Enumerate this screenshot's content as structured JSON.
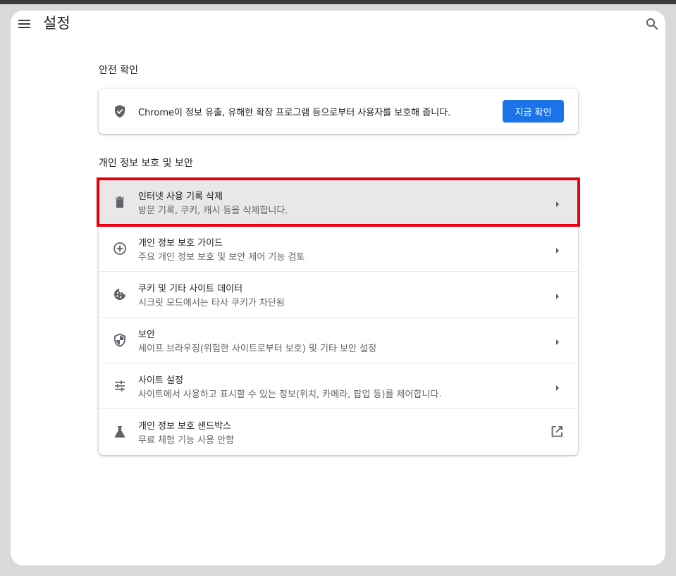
{
  "header": {
    "title": "설정",
    "menu_icon": "hamburger-menu-icon",
    "search_icon": "search-icon"
  },
  "safety_check": {
    "section_title": "안전 확인",
    "description": "Chrome이 정보 유출, 유해한 확장 프로그램 등으로부터 사용자를 보호해 줍니다.",
    "button_label": "지금 확인",
    "icon": "shield-check-icon"
  },
  "privacy": {
    "section_title": "개인 정보 보호 및 보안",
    "items": [
      {
        "title": "인터넷 사용 기록 삭제",
        "subtitle": "방문 기록, 쿠키, 캐시 등을 삭제합니다.",
        "icon": "trash-icon"
      },
      {
        "title": "개인 정보 보호 가이드",
        "subtitle": "주요 개인 정보 보호 및 보안 제어 기능 검토",
        "icon": "compass-icon"
      },
      {
        "title": "쿠키 및 기타 사이트 데이터",
        "subtitle": "시크릿 모드에서는 타사 쿠키가 차단됨",
        "icon": "cookie-icon"
      },
      {
        "title": "보안",
        "subtitle": "세이프 브라우징(위험한 사이트로부터 보호) 및 기타 보안 설정",
        "icon": "shield-icon"
      },
      {
        "title": "사이트 설정",
        "subtitle": "사이트에서 사용하고 표시할 수 있는 정보(위치, 카메라, 팝업 등)를 제어합니다.",
        "icon": "sliders-icon"
      },
      {
        "title": "개인 정보 보호 샌드박스",
        "subtitle": "무료 체험 기능 사용 안함",
        "icon": "flask-icon"
      }
    ]
  },
  "colors": {
    "accent": "#1a73e8",
    "highlight": "#e8000e",
    "hovered_row": "#e8e8e8"
  }
}
